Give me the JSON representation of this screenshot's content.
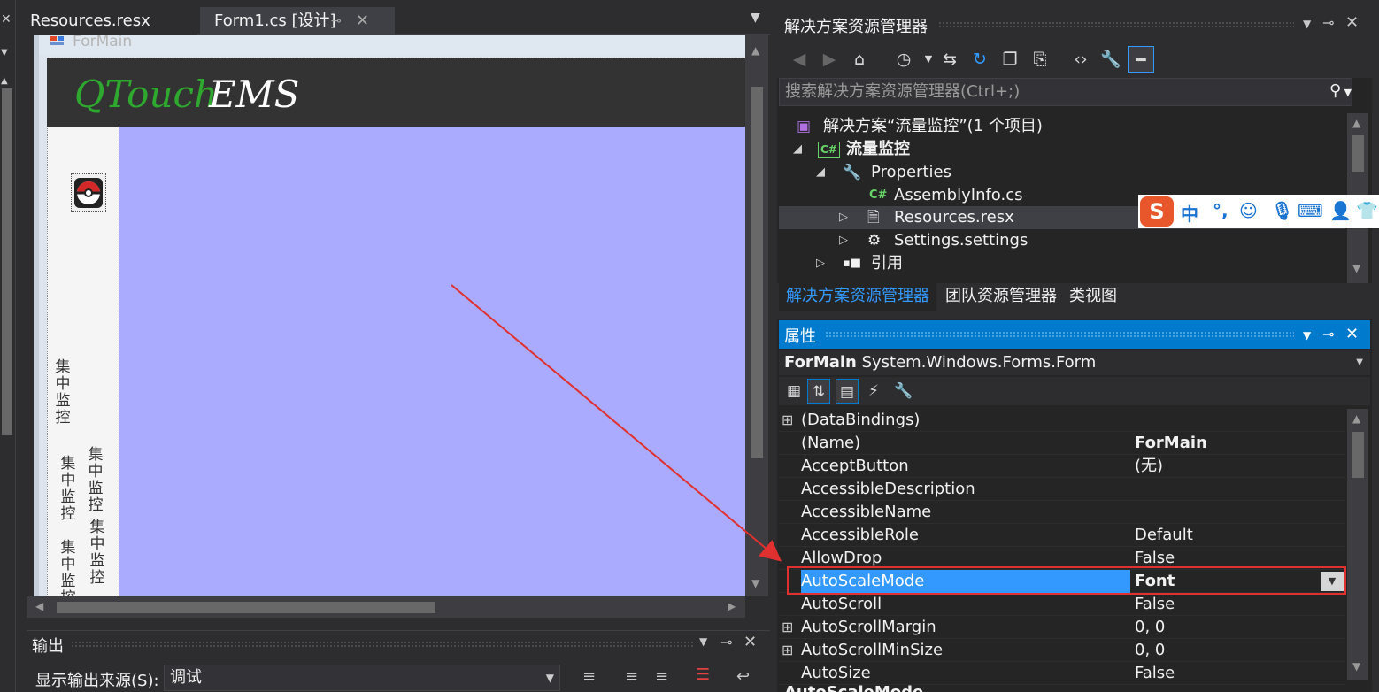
{
  "doc_tabs": {
    "tab1": "Resources.resx",
    "tab2": "Form1.cs [设计]",
    "pin_glyph": "⊸",
    "close_glyph": "✕",
    "dropdown_glyph": "▼"
  },
  "designer": {
    "form_caption": "ForMain",
    "brand_green": "QTouch",
    "brand_white": "EMS",
    "side_labels": [
      "集中监控",
      "集中监控",
      "集中监控",
      "集中监控",
      "集中监控"
    ]
  },
  "output": {
    "title": "输出",
    "source_label": "显示输出来源(S):",
    "source_value": "调试"
  },
  "solution_explorer": {
    "title": "解决方案资源管理器",
    "search_placeholder": "搜索解决方案资源管理器(Ctrl+;)",
    "tree": [
      {
        "label": "解决方案“流量监控”(1 个项目)",
        "icon": "solution-icon"
      },
      {
        "label": "流量监控",
        "icon": "csharp-project-icon"
      },
      {
        "label": "Properties",
        "icon": "wrench-icon"
      },
      {
        "label": "AssemblyInfo.cs",
        "icon": "csharp-file-icon"
      },
      {
        "label": "Resources.resx",
        "icon": "resx-file-icon"
      },
      {
        "label": "Settings.settings",
        "icon": "gear-icon"
      },
      {
        "label": "引用",
        "icon": "references-icon"
      }
    ],
    "tabs": [
      "解决方案资源管理器",
      "团队资源管理器",
      "类视图"
    ]
  },
  "ime": {
    "logo": "S",
    "mode": "中",
    "punct": "°,"
  },
  "properties": {
    "title": "属性",
    "object_name": "ForMain",
    "object_type": "System.Windows.Forms.Form",
    "rows": [
      {
        "name": "(DataBindings)",
        "value": "",
        "expandable": true
      },
      {
        "name": "(Name)",
        "value": "ForMain",
        "bold": true
      },
      {
        "name": "AcceptButton",
        "value": "(无)"
      },
      {
        "name": "AccessibleDescription",
        "value": ""
      },
      {
        "name": "AccessibleName",
        "value": ""
      },
      {
        "name": "AccessibleRole",
        "value": "Default"
      },
      {
        "name": "AllowDrop",
        "value": "False"
      },
      {
        "name": "AutoScaleMode",
        "value": "Font",
        "selected": true
      },
      {
        "name": "AutoScroll",
        "value": "False"
      },
      {
        "name": "AutoScrollMargin",
        "value": "0, 0",
        "expandable": true
      },
      {
        "name": "AutoScrollMinSize",
        "value": "0, 0",
        "expandable": true
      },
      {
        "name": "AutoSize",
        "value": "False"
      }
    ],
    "description_peek": "AutoScaleMode"
  },
  "colors": {
    "accent": "#007acc",
    "selection": "#3399ff",
    "annotation_red": "#e03030",
    "content_area": "#aaaaff",
    "brand_green": "#2ea82e"
  }
}
